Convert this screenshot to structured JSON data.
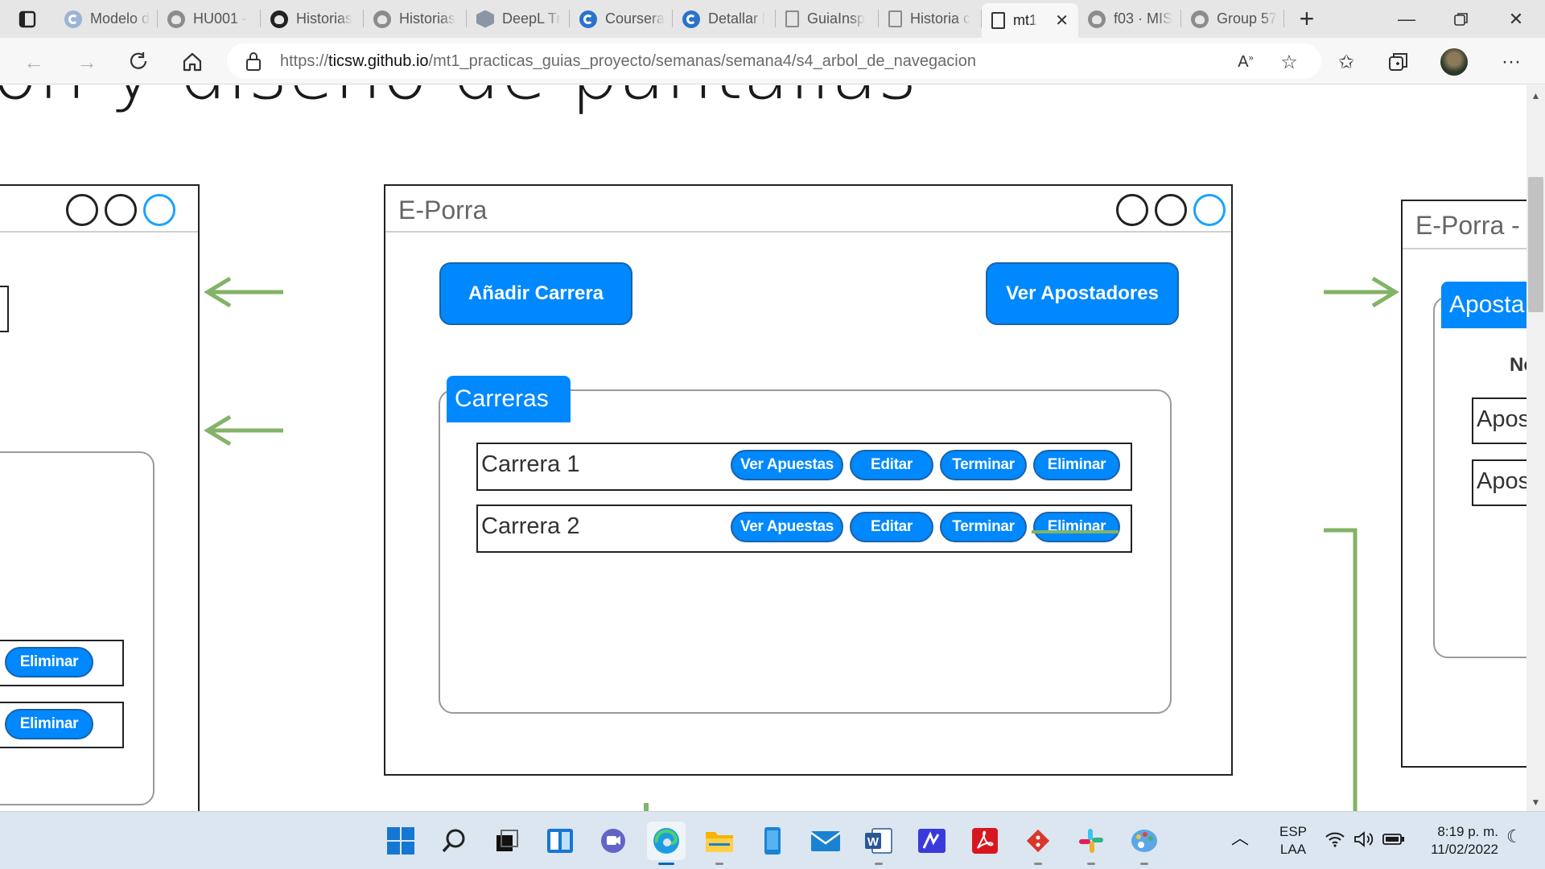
{
  "tabs": [
    {
      "title": "Modelo d",
      "icon": "coursera-icon",
      "active": false
    },
    {
      "title": "HU001 -",
      "icon": "github-icon",
      "active": false
    },
    {
      "title": "Historias",
      "icon": "github-icon",
      "active": false
    },
    {
      "title": "Historias",
      "icon": "github-icon",
      "active": false
    },
    {
      "title": "DeepL Tr",
      "icon": "deepl-icon",
      "active": false
    },
    {
      "title": "Coursera",
      "icon": "coursera-icon",
      "active": false
    },
    {
      "title": "Detallar l",
      "icon": "coursera-icon",
      "active": false
    },
    {
      "title": "GuiaInsp",
      "icon": "page-icon",
      "active": false
    },
    {
      "title": "Historia c",
      "icon": "page-icon",
      "active": false
    },
    {
      "title": "mt1",
      "icon": "page-icon",
      "active": true
    },
    {
      "title": "f03 · MIS",
      "icon": "github-icon",
      "active": false
    },
    {
      "title": "Group 57",
      "icon": "github-icon",
      "active": false
    }
  ],
  "address": {
    "prefix": "https://",
    "host": "ticsw.github.io",
    "path": "/mt1_practicas_guias_proyecto/semanas/semana4/s4_arbol_de_navegacion"
  },
  "page": {
    "heading": "ón y diseño de pantallas"
  },
  "left_mock": {
    "row_buttons": [
      "Eliminar",
      "Eliminar"
    ]
  },
  "center_mock": {
    "title": "E-Porra",
    "add_race_button": "Añadir Carrera",
    "view_bettors_button": "Ver Apostadores",
    "group_label": "Carreras",
    "rows": [
      {
        "label": "Carrera 1",
        "buttons": [
          "Ver Apuestas",
          "Editar",
          "Terminar",
          "Eliminar"
        ]
      },
      {
        "label": "Carrera 2",
        "buttons": [
          "Ver Apuestas",
          "Editar",
          "Terminar",
          "Eliminar"
        ]
      }
    ]
  },
  "right_mock": {
    "title": "E-Porra -",
    "group_label": "Aposta",
    "column_header": "No",
    "rows": [
      "Apos",
      "Apos"
    ]
  },
  "colors": {
    "accent_blue": "#0088ff",
    "arrow_green": "#82b366",
    "taskbar": "#dbe6f1"
  },
  "tray": {
    "lang_top": "ESP",
    "lang_bottom": "LAA",
    "time": "8:19 p. m.",
    "date": "11/02/2022"
  }
}
